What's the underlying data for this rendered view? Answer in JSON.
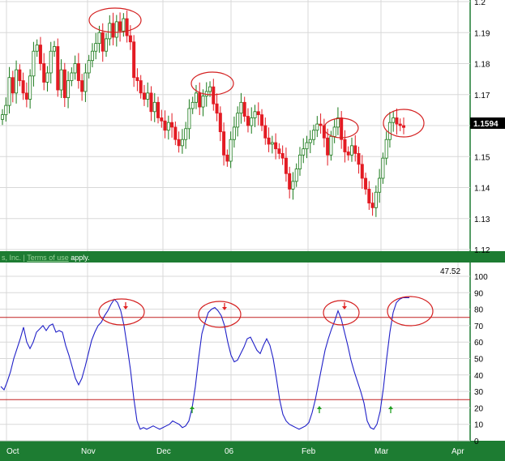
{
  "chart_data": [
    {
      "type": "candlestick",
      "title": "",
      "xlabel": "",
      "ylabel": "",
      "ylim": [
        1.12,
        1.2
      ],
      "y_ticks": [
        "1.12",
        "1.13",
        "1.14",
        "1.15",
        "1.16",
        "1.17",
        "1.18",
        "1.19",
        "1.2"
      ],
      "last_price_label": "1.1594",
      "grid": true,
      "colors": {
        "up": "#1a7a1a",
        "down": "#e31b23",
        "grid": "#d8d8d8",
        "frame": "#1d7c32",
        "highlight": "#d42020"
      },
      "candles_close": [
        1.1635,
        1.1665,
        1.1755,
        1.1705,
        1.178,
        1.1745,
        1.1705,
        1.1685,
        1.176,
        1.184,
        1.186,
        1.18,
        1.174,
        1.177,
        1.184,
        1.1855,
        1.1715,
        1.178,
        1.169,
        1.1745,
        1.177,
        1.18,
        1.1745,
        1.171,
        1.177,
        1.181,
        1.184,
        1.1865,
        1.19,
        1.184,
        1.188,
        1.193,
        1.1885,
        1.1935,
        1.1905,
        1.1945,
        1.189,
        1.187,
        1.1755,
        1.1745,
        1.1705,
        1.1685,
        1.1705,
        1.1645,
        1.1675,
        1.1625,
        1.1615,
        1.1585,
        1.161,
        1.1595,
        1.1555,
        1.1535,
        1.1555,
        1.159,
        1.1655,
        1.1675,
        1.1705,
        1.166,
        1.1695,
        1.171,
        1.1725,
        1.167,
        1.164,
        1.158,
        1.1505,
        1.1485,
        1.1555,
        1.1595,
        1.164,
        1.1675,
        1.163,
        1.16,
        1.1625,
        1.1645,
        1.1635,
        1.16,
        1.156,
        1.154,
        1.1545,
        1.1525,
        1.151,
        1.1495,
        1.1445,
        1.1395,
        1.142,
        1.146,
        1.1505,
        1.1525,
        1.1545,
        1.1555,
        1.1585,
        1.1605,
        1.16,
        1.156,
        1.1505,
        1.1565,
        1.1595,
        1.1625,
        1.1555,
        1.1515,
        1.1505,
        1.1535,
        1.151,
        1.1475,
        1.143,
        1.1395,
        1.135,
        1.1335,
        1.1385,
        1.143,
        1.1495,
        1.1555,
        1.161,
        1.1625,
        1.1605,
        1.16,
        1.1594
      ],
      "highlights": [
        "Nov peak",
        "Dec peak",
        "Feb peak",
        "Mar peak"
      ]
    },
    {
      "type": "line",
      "title": "",
      "ylim": [
        0,
        100
      ],
      "y_ticks": [
        "0",
        "10",
        "20",
        "30",
        "40",
        "50",
        "60",
        "70",
        "80",
        "90",
        "100"
      ],
      "current_value_label": "47.52",
      "reference_lines": [
        75,
        25
      ],
      "series": [
        {
          "values": [
            33,
            31,
            36,
            42,
            50,
            56,
            62,
            69,
            60,
            56,
            60,
            66,
            68,
            70,
            67,
            70,
            71,
            66,
            67,
            66,
            58,
            52,
            45,
            38,
            34,
            38,
            45,
            53,
            61,
            66,
            70,
            72,
            76,
            79,
            83,
            86,
            84,
            79,
            70,
            57,
            43,
            26,
            12,
            7,
            8,
            7,
            8,
            9,
            8,
            7,
            8,
            9,
            10,
            12,
            11,
            10,
            8,
            9,
            12,
            20,
            33,
            50,
            65,
            72,
            78,
            80,
            81,
            79,
            76,
            70,
            60,
            52,
            48,
            49,
            53,
            57,
            62,
            63,
            59,
            55,
            53,
            58,
            62,
            58,
            50,
            38,
            25,
            16,
            12,
            10,
            9,
            8,
            7,
            8,
            9,
            11,
            17,
            25,
            35,
            45,
            55,
            62,
            68,
            73,
            79,
            74,
            66,
            58,
            49,
            42,
            36,
            30,
            23,
            12,
            8,
            7,
            10,
            18,
            32,
            50,
            66,
            78,
            84,
            86,
            87,
            87,
            87
          ]
        }
      ],
      "arrows": [
        {
          "kind": "sell",
          "label": "Nov"
        },
        {
          "kind": "sell",
          "label": "Dec"
        },
        {
          "kind": "sell",
          "label": "Feb"
        },
        {
          "kind": "buy",
          "label": "Dec"
        },
        {
          "kind": "buy",
          "label": "Feb"
        },
        {
          "kind": "buy",
          "label": "Mar"
        }
      ]
    }
  ],
  "x_axis": {
    "labels": [
      "Oct",
      "Nov",
      "Dec",
      "06",
      "Feb",
      "Mar",
      "Apr"
    ]
  },
  "credit": {
    "prefix": "s, Inc. | ",
    "link": "Terms of use",
    "suffix": " apply."
  }
}
